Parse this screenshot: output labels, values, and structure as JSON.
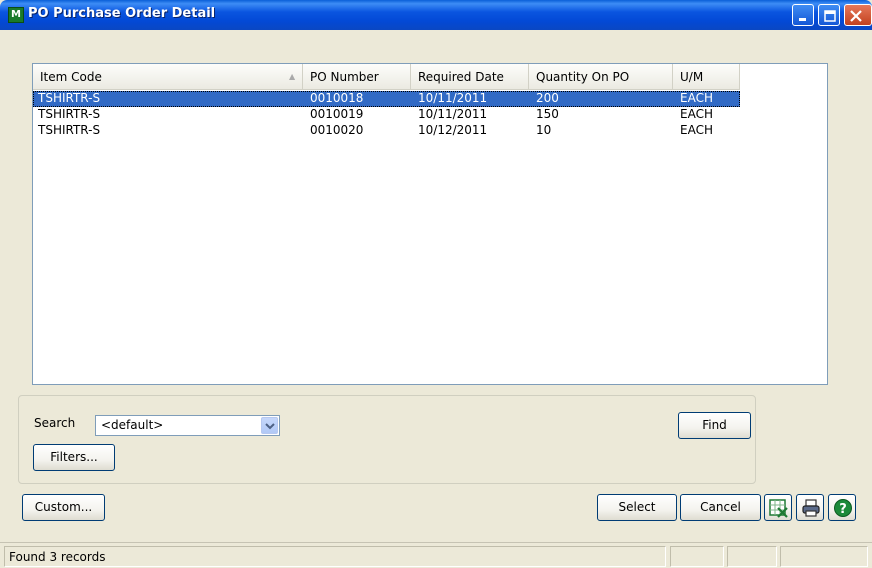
{
  "window": {
    "title": "PO Purchase Order Detail",
    "app_icon": "M"
  },
  "list": {
    "columns": [
      "Item Code",
      "PO Number",
      "Required Date",
      "Quantity On PO",
      "U/M"
    ],
    "rows": [
      {
        "item_code": "TSHIRTR-S",
        "po_number": "0010018",
        "required_date": "10/11/2011",
        "quantity": "200",
        "um": "EACH"
      },
      {
        "item_code": "TSHIRTR-S",
        "po_number": "0010019",
        "required_date": "10/11/2011",
        "quantity": "150",
        "um": "EACH"
      },
      {
        "item_code": "TSHIRTR-S",
        "po_number": "0010020",
        "required_date": "10/12/2011",
        "quantity": "10",
        "um": "EACH"
      }
    ]
  },
  "search": {
    "label": "Search",
    "value": "<default>"
  },
  "buttons": {
    "find": "Find",
    "filters": "Filters...",
    "custom": "Custom...",
    "select": "Select",
    "cancel": "Cancel"
  },
  "status": {
    "text": "Found 3 records"
  },
  "colors": {
    "title_bar": "#0a55e0",
    "selection": "#316ac5",
    "face": "#ece9d8"
  }
}
